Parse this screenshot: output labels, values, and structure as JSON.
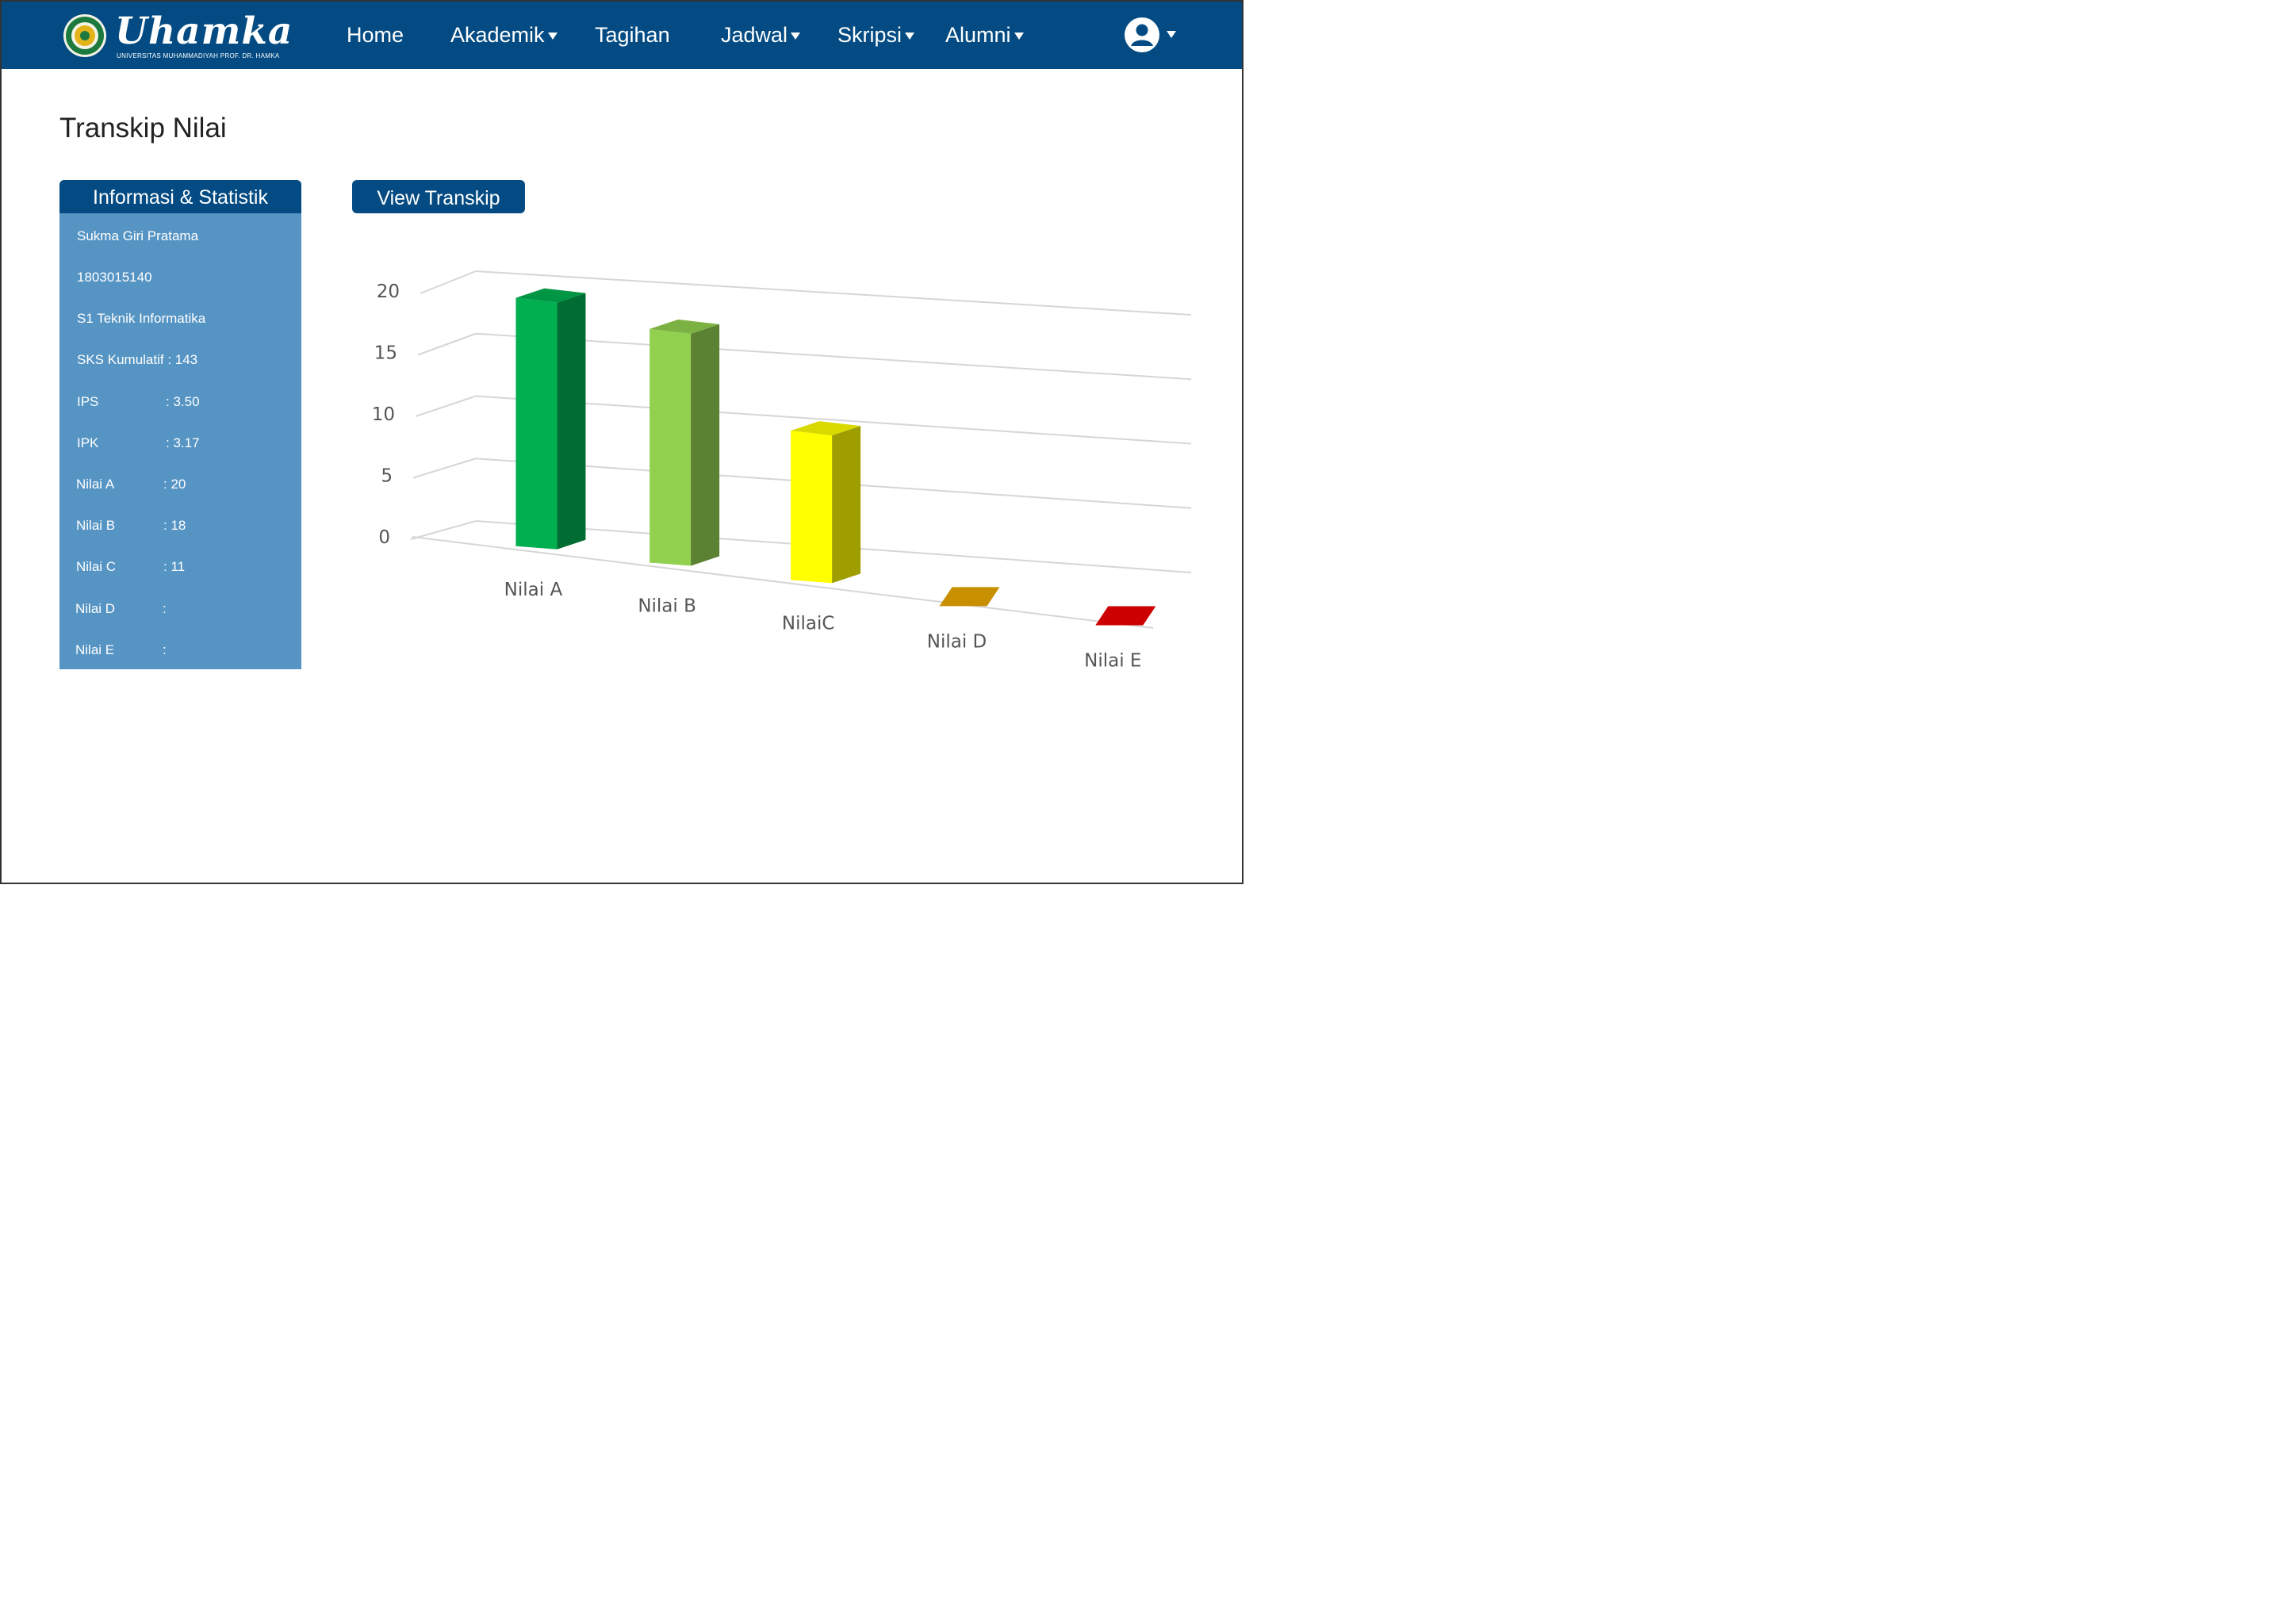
{
  "nav": {
    "brand": "Uhamka",
    "brand_sub": "UNIVERSITAS MUHAMMADIYAH PROF. DR. HAMKA",
    "items": [
      {
        "label": "Home",
        "dropdown": false
      },
      {
        "label": "Akademik",
        "dropdown": true
      },
      {
        "label": "Tagihan",
        "dropdown": false
      },
      {
        "label": "Jadwal",
        "dropdown": true
      },
      {
        "label": "Skripsi",
        "dropdown": true
      },
      {
        "label": "Alumni",
        "dropdown": true
      }
    ],
    "user_icon": "user-circle-icon"
  },
  "page": {
    "title": "Transkip Nilai"
  },
  "info": {
    "header": "Informasi & Statistik",
    "name": "Sukma Giri Pratama",
    "nim": "1803015140",
    "program": "S1 Teknik Informatika",
    "sks": "SKS Kumulatif : 143",
    "ips_label": "IPS",
    "ips_value": ": 3.50",
    "ipk_label": "IPK",
    "ipk_value": ": 3.17",
    "nilai_a_label": "Nilai A",
    "nilai_a_value": ": 20",
    "nilai_b_label": "Nilai B",
    "nilai_b_value": ": 18",
    "nilai_c_label": "Nilai C",
    "nilai_c_value": ": 11",
    "nilai_d_label": "Nilai D",
    "nilai_d_value": ":",
    "nilai_e_label": "Nilai E",
    "nilai_e_value": ":"
  },
  "actions": {
    "view_transkip": "View Transkip"
  },
  "colors": {
    "brand": "#034b82",
    "panel": "#5694c4"
  },
  "chart_data": {
    "type": "bar",
    "categories": [
      "Nilai A",
      "Nilai B",
      "NilaiC",
      "Nilai D",
      "Nilai E"
    ],
    "values": [
      20,
      18,
      11,
      0,
      0
    ],
    "colors": [
      "#00b050",
      "#92d050",
      "#ffff00",
      "#c89000",
      "#cc0000"
    ],
    "yticks": [
      "0",
      "5",
      "10",
      "15",
      "20"
    ],
    "ylim": [
      0,
      20
    ],
    "grid": true
  }
}
